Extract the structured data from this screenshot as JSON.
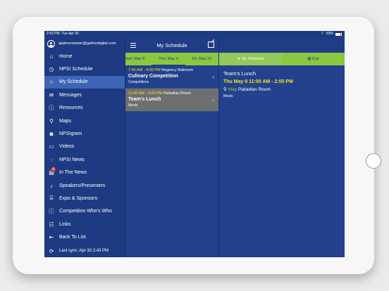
{
  "status": {
    "time": "2:43 PM",
    "date": "Tue Apr 30",
    "battery": "83%"
  },
  "sidebar": {
    "user": "applereviewer@gatherdigital.com",
    "items": [
      {
        "label": "Home",
        "icon": "home-icon"
      },
      {
        "label": "NPSI Schedule",
        "icon": "clock-icon"
      },
      {
        "label": "My Schedule",
        "icon": "star-icon",
        "active": true
      },
      {
        "label": "Messages",
        "icon": "envelope-icon"
      },
      {
        "label": "Resources",
        "icon": "info-icon"
      },
      {
        "label": "Maps",
        "icon": "map-pin-icon"
      },
      {
        "label": "NPSIgram",
        "icon": "camera-icon"
      },
      {
        "label": "Videos",
        "icon": "monitor-icon"
      },
      {
        "label": "NPSI News",
        "icon": "chat-icon"
      },
      {
        "label": "In The News",
        "icon": "newspaper-icon",
        "badge": "4"
      },
      {
        "label": "Speakers/Presenters",
        "icon": "microphone-icon"
      },
      {
        "label": "Expo & Sponsors",
        "icon": "store-icon"
      },
      {
        "label": "Competition Who's Who",
        "icon": "info-icon"
      },
      {
        "label": "Links",
        "icon": "links-icon"
      },
      {
        "label": "Back To List",
        "icon": "exit-icon"
      }
    ],
    "sync": "Last sync:  Apr 30 2:43 PM"
  },
  "schedule": {
    "title": "My Schedule",
    "dates": [
      "Wed: May 8",
      "Thu: May 9",
      "Fri: May 10"
    ],
    "events": [
      {
        "time": "7:45 AM - 4:05 PM",
        "room": "Regency Ballroom",
        "title": "Culinary Competition",
        "category": "Competitions"
      },
      {
        "time": "11:00 AM - 2:00 PM",
        "room": "Palladian Room",
        "title": "Team's Lunch",
        "category": "Meals"
      }
    ]
  },
  "detail": {
    "tab_schedule": "My Schedule",
    "tab_ical": "iCal",
    "title": "Team's Lunch",
    "time": "Thu  May 9 11:00 AM - 2:00 PM",
    "map_label": "Map",
    "room": "Palladian Room",
    "category": "Meals"
  },
  "colors": {
    "accent": "#8dc63f",
    "time": "#f5e21c",
    "background": "#203f8a"
  }
}
